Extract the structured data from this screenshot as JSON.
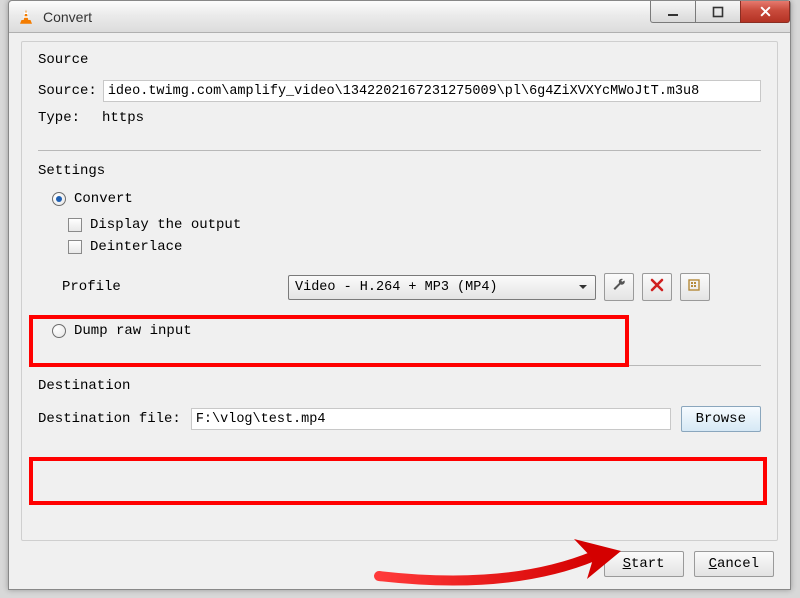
{
  "window": {
    "title": "Convert"
  },
  "source": {
    "legend": "Source",
    "source_label": "Source:",
    "source_value": "ideo.twimg.com\\amplify_video\\1342202167231275009\\pl\\6g4ZiXVXYcMWoJtT.m3u8",
    "type_label": "Type:",
    "type_value": "https"
  },
  "settings": {
    "legend": "Settings",
    "convert_label": "Convert",
    "display_label": "Display the output",
    "deinterlace_label": "Deinterlace",
    "profile_label": "Profile",
    "profile_value": "Video - H.264 + MP3 (MP4)",
    "dump_label": "Dump raw input"
  },
  "destination": {
    "legend": "Destination",
    "file_label": "Destination file:",
    "file_value": "F:\\vlog\\test.mp4",
    "browse_label": "Browse"
  },
  "footer": {
    "start_pre": "S",
    "start_rest": "tart",
    "cancel_pre": "C",
    "cancel_rest": "ancel"
  }
}
